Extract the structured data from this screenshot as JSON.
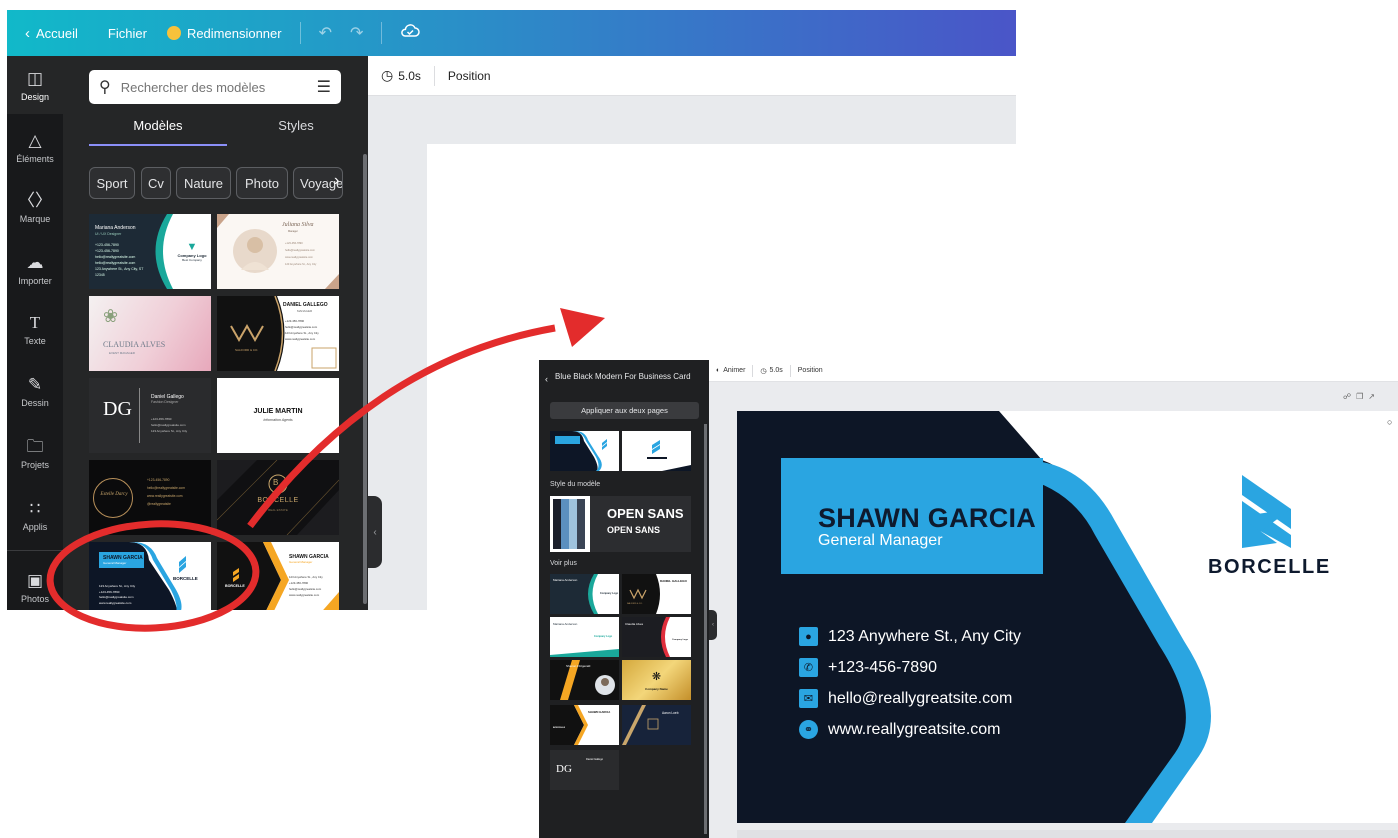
{
  "editor": {
    "topbar": {
      "home_label": "Accueil",
      "file_label": "Fichier",
      "resize_label": "Redimensionner"
    },
    "rail": [
      {
        "label": "Design",
        "icon": "layout-icon"
      },
      {
        "label": "Éléments",
        "icon": "shapes-icon"
      },
      {
        "label": "Marque",
        "icon": "brand-icon"
      },
      {
        "label": "Importer",
        "icon": "cloud-upload-icon"
      },
      {
        "label": "Texte",
        "icon": "text-icon"
      },
      {
        "label": "Dessin",
        "icon": "draw-icon"
      },
      {
        "label": "Projets",
        "icon": "folder-icon"
      },
      {
        "label": "Applis",
        "icon": "apps-grid-icon"
      },
      {
        "label": "Photos",
        "icon": "photo-icon"
      }
    ],
    "search": {
      "placeholder": "Rechercher des modèles"
    },
    "tabs": [
      "Modèles",
      "Styles"
    ],
    "chips": [
      "Sport",
      "Cv",
      "Nature",
      "Photo",
      "Voyage"
    ],
    "toolbar": {
      "duration": "5.0s",
      "position_label": "Position"
    },
    "templates": {
      "t1": {
        "name": "Mariana Anderson",
        "title": "UI / UX Designer",
        "phone": "+123-456-7890",
        "phone2": "+123-456-7890",
        "email": "hello@reallygreatsite.com",
        "email2": "hello@reallygreatsite.com",
        "address": "123 Anywhere St., Any City, ST 12345",
        "logo": "Company Logo",
        "company": "Best Company"
      },
      "t2": {
        "name": "Juliana Silva",
        "title": "Manager",
        "phone": "+123-456-7890",
        "email": "hello@reallygreatsite.com",
        "site": "www.reallygreatsite.com",
        "address": "123 Anywhere St., Any City"
      },
      "t3": {
        "name": "CLAUDIA ALVES",
        "title": "EVENT MANAGER"
      },
      "t4": {
        "name": "DANIEL GALLEGO",
        "title": "MANAGER",
        "company": "SALFORD & CO.",
        "phone": "+123-456-7890",
        "email": "hello@reallygreatsite.com",
        "address": "123 Anywhere St., Any City",
        "site": "www.reallygreatsite.com"
      },
      "t5": {
        "monogram": "DG",
        "name": "Daniel Gallego",
        "title": "Fashion Designer",
        "phone": "+123-456-7890",
        "email": "hello@reallygreatsite.com",
        "address": "123 Anywhere St., Any City"
      },
      "t6": {
        "name": "JULIE MARTIN",
        "title": "Information Agents"
      },
      "t7": {
        "signature": "Estelle Darcy",
        "phone": "+123-456-7890",
        "email": "hello@reallygreatsite.com",
        "site": "www.reallygreatsite.com",
        "social": "@reallygreatsite"
      },
      "t8": {
        "brand": "BORCELLE",
        "slogan": "REAL ESTATE"
      },
      "t9": {
        "name": "SHAWN GARCIA",
        "role": "General Manager",
        "brand": "BORCELLE",
        "address": "123 Anywhere St., Any City",
        "phone": "+123-456-7890",
        "email": "hello@reallygreatsite.com",
        "site": "www.reallygreatsite.com"
      },
      "t10": {
        "brand": "BORCELLE",
        "name": "SHAWN GARCIA",
        "role": "General Manager",
        "address": "123 Anywhere St., Any City",
        "phone": "+123-456-7890",
        "email": "hello@reallygreatsite.com",
        "site": "www.reallygreatsite.com"
      }
    }
  },
  "detail": {
    "panel": {
      "title": "Blue Black Modern For Business Card",
      "apply_label": "Appliquer aux deux pages",
      "style_label": "Style du modèle",
      "font_heading": "OPEN SANS",
      "font_body": "OPEN SANS",
      "more_label": "Voir plus",
      "swatch_colors": [
        "#1b1f2b",
        "#5b8fbf",
        "#9fc3de",
        "#3a4455"
      ]
    },
    "toolbar": {
      "animate_label": "Animer",
      "duration": "5.0s",
      "position_label": "Position"
    },
    "mini_cards": {
      "m3": {
        "name": "Mariana Anderson",
        "logo": "Company Logo"
      },
      "m4": {
        "name": "DANIEL GALLEGO",
        "company": "SALFORD & CO."
      },
      "m5": {
        "name": "Mariana Anderson",
        "logo": "Company Logo"
      },
      "m6": {
        "name": "Claudia Alves",
        "logo": "Company Logo"
      },
      "m7": {
        "name": "Shanon Fitzgerald"
      },
      "m8": {
        "company": "Company Name"
      },
      "m9": {
        "name": "SHAWN GARCIA",
        "brand": "BORCELLE"
      },
      "m10": {
        "name": "Aaron Loeb"
      },
      "m11": {
        "monogram": "DG",
        "name": "Daniel Gallego"
      }
    },
    "card": {
      "name": "SHAWN GARCIA",
      "role": "General Manager",
      "brand": "BORCELLE",
      "address": "123 Anywhere St., Any City",
      "phone": "+123-456-7890",
      "email": "hello@reallygreatsite.com",
      "website": "www.reallygreatsite.com",
      "colors": {
        "navy": "#0d1626",
        "cyan": "#2aa5e1",
        "white": "#ffffff"
      }
    }
  },
  "annotations": {
    "highlight_color": "#e32c2c"
  }
}
